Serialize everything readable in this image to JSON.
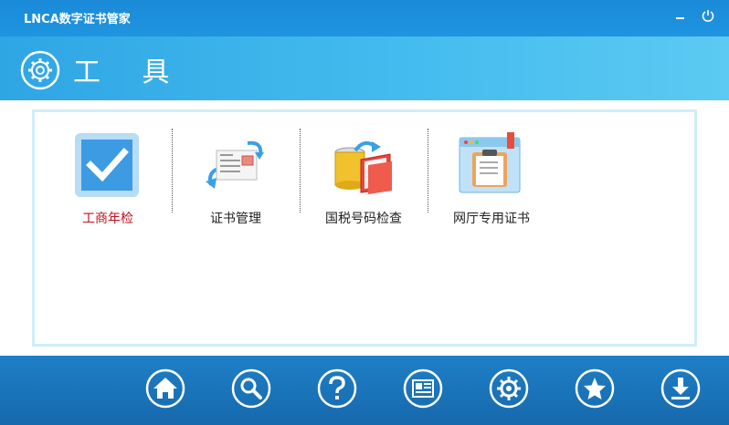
{
  "window": {
    "title": "LNCA数字证书管家"
  },
  "header": {
    "title": "工 具",
    "icon": "gear-icon"
  },
  "tools": [
    {
      "label": "工商年检",
      "icon": "checkmark-icon",
      "active": true
    },
    {
      "label": "证书管理",
      "icon": "certificate-exchange-icon",
      "active": false
    },
    {
      "label": "国税号码检查",
      "icon": "folder-archive-icon",
      "active": false
    },
    {
      "label": "网厅专用证书",
      "icon": "clipboard-browser-icon",
      "active": false
    }
  ],
  "bottom_nav": [
    {
      "icon": "home-icon"
    },
    {
      "icon": "search-icon"
    },
    {
      "icon": "help-icon"
    },
    {
      "icon": "news-icon"
    },
    {
      "icon": "gear-icon"
    },
    {
      "icon": "star-icon"
    },
    {
      "icon": "download-icon"
    }
  ],
  "colors": {
    "titlebar": "#1a8ad8",
    "header": "#46bdef",
    "bottombar": "#1f7fc6",
    "active_label": "#c0101a",
    "panel_border": "#cfeef8"
  }
}
